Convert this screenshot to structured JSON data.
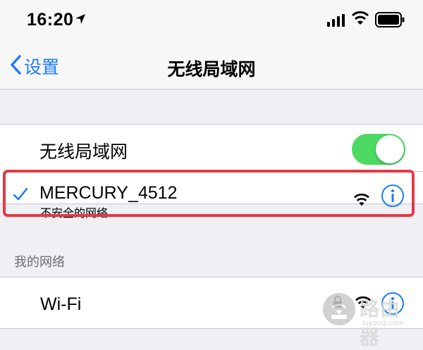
{
  "status_bar": {
    "time": "16:20",
    "icons": [
      "location-arrow-icon",
      "cellular-signal-icon",
      "wifi-icon",
      "battery-icon"
    ]
  },
  "nav": {
    "back_label": "设置",
    "title": "无线局域网"
  },
  "wlan_toggle": {
    "label": "无线局域网",
    "state": "on"
  },
  "connected_network": {
    "name": "MERCURY_4512",
    "subtitle": "不安全的网络",
    "icons": [
      "checkmark-icon",
      "wifi-icon",
      "info-icon"
    ]
  },
  "my_networks": {
    "header": "我的网络",
    "items": [
      {
        "name": "Wi-Fi",
        "icons": [
          "lock-icon",
          "wifi-icon",
          "info-icon"
        ]
      }
    ]
  },
  "watermark": {
    "text": "路由器",
    "url": "luyouqi.com"
  },
  "colors": {
    "accent": "#1a7cf5",
    "toggle_on": "#4cd964",
    "highlight": "#e53946",
    "background": "#efeff4"
  }
}
